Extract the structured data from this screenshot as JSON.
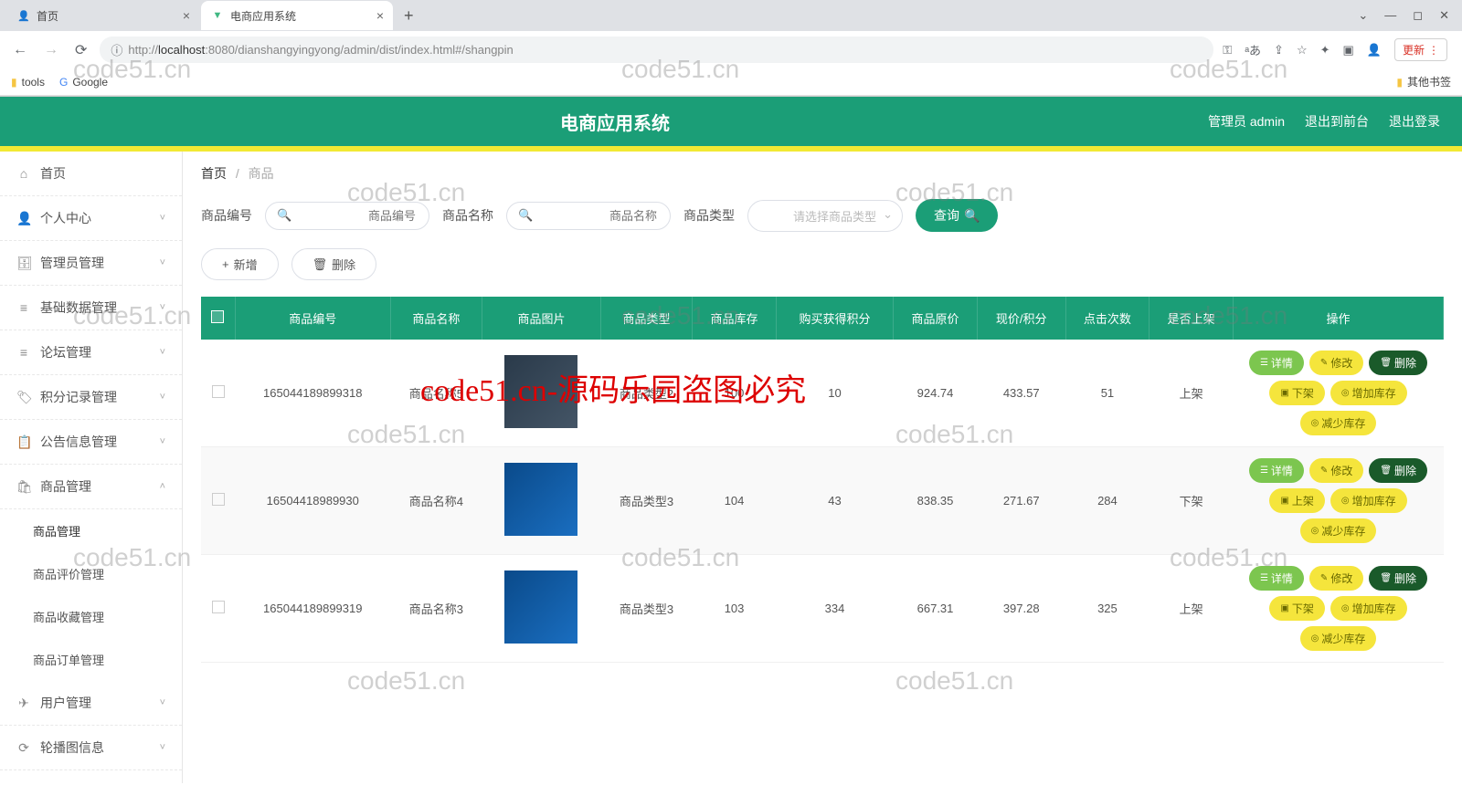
{
  "browser": {
    "tabs": [
      {
        "title": "首页",
        "active": false
      },
      {
        "title": "电商应用系统",
        "active": true
      }
    ],
    "url_host": "localhost",
    "url_prefix": "http://",
    "url_port_path": ":8080/dianshangyingyong/admin/dist/index.html#/shangpin",
    "update_label": "更新",
    "bookmarks": {
      "tools": "tools",
      "google": "Google",
      "other": "其他书签"
    }
  },
  "header": {
    "title": "电商应用系统",
    "admin_label": "管理员 admin",
    "to_front": "退出到前台",
    "logout": "退出登录"
  },
  "sidebar": {
    "items": [
      {
        "icon": "⌂",
        "label": "首页",
        "expandable": false
      },
      {
        "icon": "👤",
        "label": "个人中心",
        "expandable": true
      },
      {
        "icon": "🗄",
        "label": "管理员管理",
        "expandable": true
      },
      {
        "icon": "≡",
        "label": "基础数据管理",
        "expandable": true
      },
      {
        "icon": "≡",
        "label": "论坛管理",
        "expandable": true
      },
      {
        "icon": "🏷",
        "label": "积分记录管理",
        "expandable": true
      },
      {
        "icon": "📋",
        "label": "公告信息管理",
        "expandable": true
      },
      {
        "icon": "🛍",
        "label": "商品管理",
        "expandable": true,
        "expanded": true
      },
      {
        "icon": "✈",
        "label": "用户管理",
        "expandable": true
      },
      {
        "icon": "⟳",
        "label": "轮播图信息",
        "expandable": true
      }
    ],
    "product_sub": [
      {
        "label": "商品管理",
        "active": true
      },
      {
        "label": "商品评价管理",
        "active": false
      },
      {
        "label": "商品收藏管理",
        "active": false
      },
      {
        "label": "商品订单管理",
        "active": false
      }
    ]
  },
  "breadcrumb": {
    "home": "首页",
    "current": "商品"
  },
  "search": {
    "code_label": "商品编号",
    "code_placeholder": "商品编号",
    "name_label": "商品名称",
    "name_placeholder": "商品名称",
    "type_label": "商品类型",
    "type_placeholder": "请选择商品类型",
    "query_btn": "查询"
  },
  "actions": {
    "add": "新增",
    "delete": "删除"
  },
  "table": {
    "headers": [
      "",
      "商品编号",
      "商品名称",
      "商品图片",
      "商品类型",
      "商品库存",
      "购买获得积分",
      "商品原价",
      "现价/积分",
      "点击次数",
      "是否上架",
      "操作"
    ],
    "op_labels": {
      "detail": "详情",
      "edit": "修改",
      "delete": "删除",
      "off": "下架",
      "on": "上架",
      "add_stock": "增加库存",
      "reduce_stock": "减少库存"
    },
    "rows": [
      {
        "code": "165044189899318",
        "name": "商品名称5",
        "img_style": "dark",
        "type": "商品类型2",
        "stock": "100",
        "points": "10",
        "orig": "924.74",
        "now": "433.57",
        "clicks": "51",
        "on_shelf": "上架",
        "shelf_action": "off"
      },
      {
        "code": "16504418989930",
        "name": "商品名称4",
        "img_style": "blue",
        "type": "商品类型3",
        "stock": "104",
        "points": "43",
        "orig": "838.35",
        "now": "271.67",
        "clicks": "284",
        "on_shelf": "下架",
        "shelf_action": "on"
      },
      {
        "code": "165044189899319",
        "name": "商品名称3",
        "img_style": "blue",
        "type": "商品类型3",
        "stock": "103",
        "points": "334",
        "orig": "667.31",
        "now": "397.28",
        "clicks": "325",
        "on_shelf": "上架",
        "shelf_action": "off"
      }
    ]
  },
  "watermark": {
    "text": "code51.cn",
    "red_text": "code51.cn-源码乐园盗图必究"
  }
}
